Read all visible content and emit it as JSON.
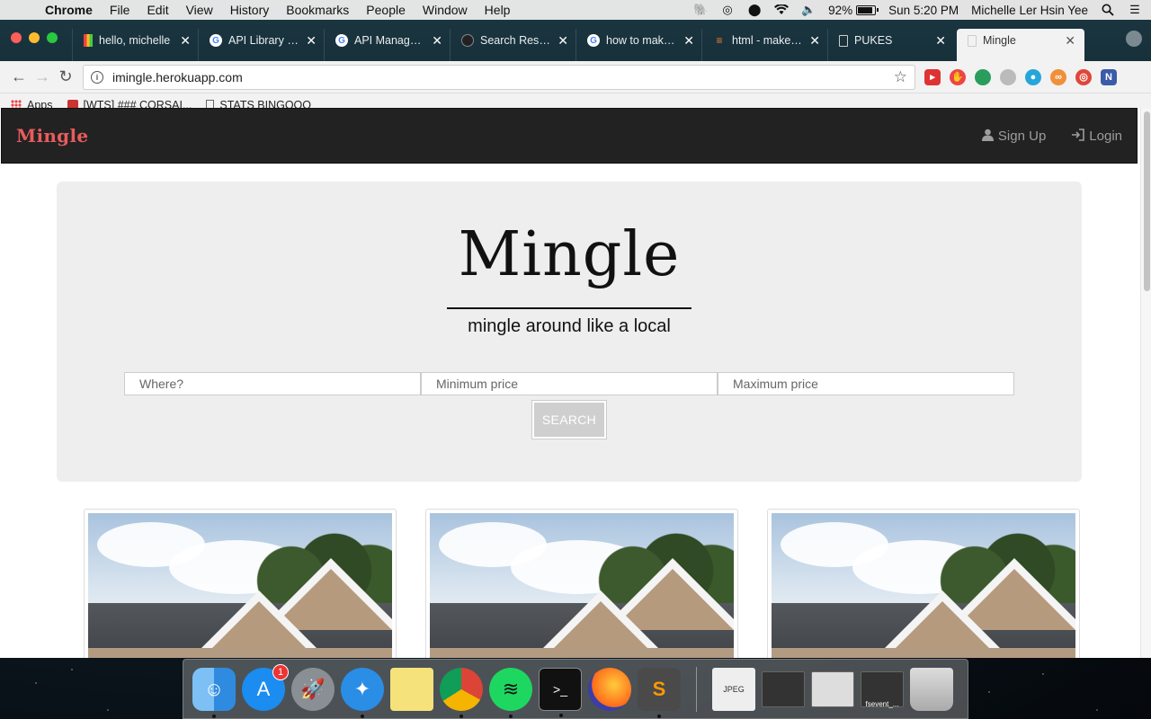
{
  "menubar": {
    "app_name": "Chrome",
    "items": [
      "File",
      "Edit",
      "View",
      "History",
      "Bookmarks",
      "People",
      "Window",
      "Help"
    ],
    "battery_percent": "92%",
    "battery_level": 0.92,
    "clock": "Sun 5:20 PM",
    "user_name": "Michelle Ler Hsin Yee"
  },
  "tabs": [
    {
      "title": "hello, michelle",
      "icon": "bar-favicon"
    },
    {
      "title": "API Library – m",
      "icon": "google-favicon"
    },
    {
      "title": "API Manager – ",
      "icon": "google-favicon"
    },
    {
      "title": "Search Results",
      "icon": "github-favicon"
    },
    {
      "title": "how to make o",
      "icon": "google-favicon"
    },
    {
      "title": "html - make sc",
      "icon": "stackoverflow-favicon"
    },
    {
      "title": "PUKES",
      "icon": "doc-favicon"
    },
    {
      "title": "Mingle",
      "icon": "doc-favicon",
      "active": true
    }
  ],
  "toolbar": {
    "url": "imingle.herokuapp.com"
  },
  "bookmarks": [
    {
      "label": "Apps",
      "icon": "apps-grid-icon"
    },
    {
      "label": "[WTS] ### CORSAI...",
      "icon": "corsair-icon"
    },
    {
      "label": "STATS BINGOOO",
      "icon": "doc-icon"
    }
  ],
  "site": {
    "brand": "Mingle",
    "nav": {
      "signup": "Sign Up",
      "login": "Login"
    },
    "hero": {
      "title": "Mingle",
      "subtitle": "mingle around like a local"
    },
    "search": {
      "where_placeholder": "Where?",
      "min_placeholder": "Minimum price",
      "max_placeholder": "Maximum price",
      "button": "SEARCH"
    },
    "listings_count_visible": 3
  },
  "dock": {
    "app_store_badge": "1",
    "thumb_caption": "fsevent_..."
  },
  "colors": {
    "brand": "#e85c5c",
    "navbar": "#222222",
    "jumbotron": "#eeeeee",
    "search_button": "#cfcfcf"
  }
}
